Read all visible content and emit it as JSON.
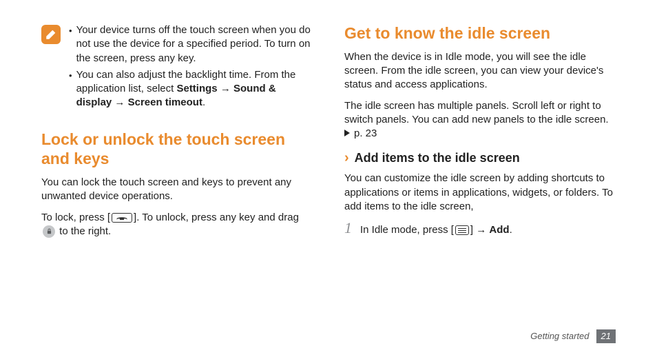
{
  "col_left": {
    "note": {
      "bullets": [
        {
          "text": "Your device turns off the touch screen when you do not use the device for a specified period. To turn on the screen, press any key."
        },
        {
          "prefix": "You can also adjust the backlight time. From the application list, select ",
          "b1": "Settings",
          "arrow1": " → ",
          "b2": "Sound & display",
          "arrow2": " → ",
          "b3": "Screen timeout",
          "suffix": "."
        }
      ]
    },
    "h2": "Lock or unlock the touch screen and keys",
    "p1": "You can lock the touch screen and keys to prevent any unwanted device operations.",
    "p2_a": "To lock, press [",
    "p2_b": "]. To unlock, press any key and drag ",
    "p2_c": " to the right."
  },
  "col_right": {
    "h2": "Get to know the idle screen",
    "p1": "When the device is in Idle mode, you will see the idle screen. From the idle screen, you can view your device's status and access applications.",
    "p2": "The idle screen has multiple panels. Scroll left or right to switch panels. You can add new panels to the idle screen.",
    "ref": "p. 23",
    "sub_h3": "Add items to the idle screen",
    "p3": "You can customize the idle screen by adding shortcuts to applications or items in applications, widgets, or folders. To add items to the idle screen,",
    "step1_num": "1",
    "step1_a": "In Idle mode, press [",
    "step1_b": "] → ",
    "step1_bold": "Add",
    "step1_c": "."
  },
  "footer": {
    "chapter": "Getting started",
    "page": "21"
  }
}
